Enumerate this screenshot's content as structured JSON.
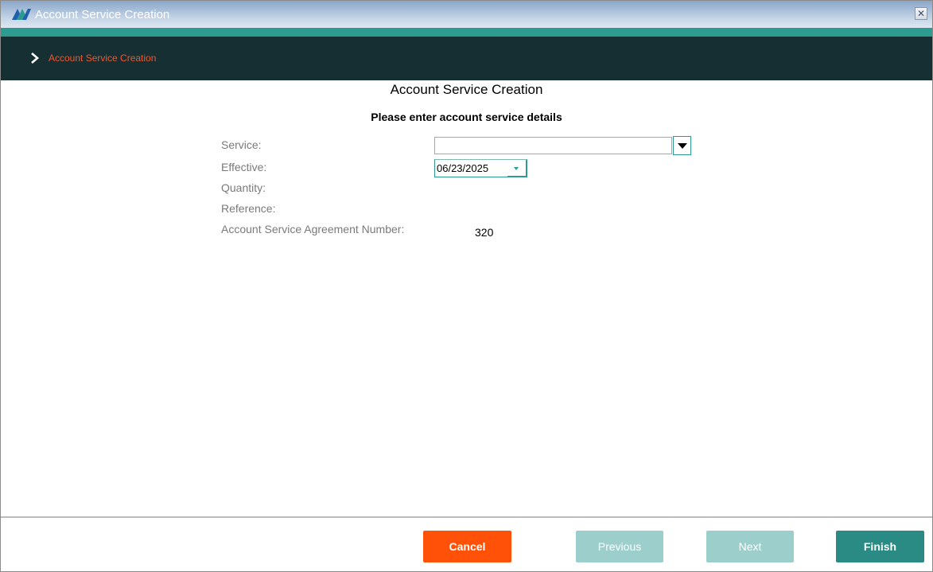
{
  "window": {
    "title": "Account Service Creation",
    "close_glyph": "✕",
    "accent_color": "#2e9b90",
    "header_bg_color": "#162f33"
  },
  "breadcrumb": {
    "items": [
      {
        "label": "Account Service Creation",
        "icon": "chevron-right-icon"
      }
    ],
    "text_color": "#f0562c"
  },
  "form": {
    "heading": "Account Service Creation",
    "subheading": "Please enter account service details",
    "fields": {
      "service": {
        "label": "Service:",
        "value": ""
      },
      "effective": {
        "label": "Effective:",
        "value": "06/23/2025"
      },
      "quantity": {
        "label": "Quantity:"
      },
      "reference": {
        "label": "Reference:"
      },
      "agreement_number": {
        "label": "Account Service Agreement Number:",
        "value": "320"
      }
    }
  },
  "footer": {
    "buttons": {
      "cancel": {
        "label": "Cancel",
        "color": "#ff5208",
        "enabled": true
      },
      "previous": {
        "label": "Previous",
        "color": "#9ccecb",
        "enabled": false
      },
      "next": {
        "label": "Next",
        "color": "#9ccecb",
        "enabled": false
      },
      "finish": {
        "label": "Finish",
        "color": "#2a8a84",
        "enabled": true
      }
    }
  }
}
